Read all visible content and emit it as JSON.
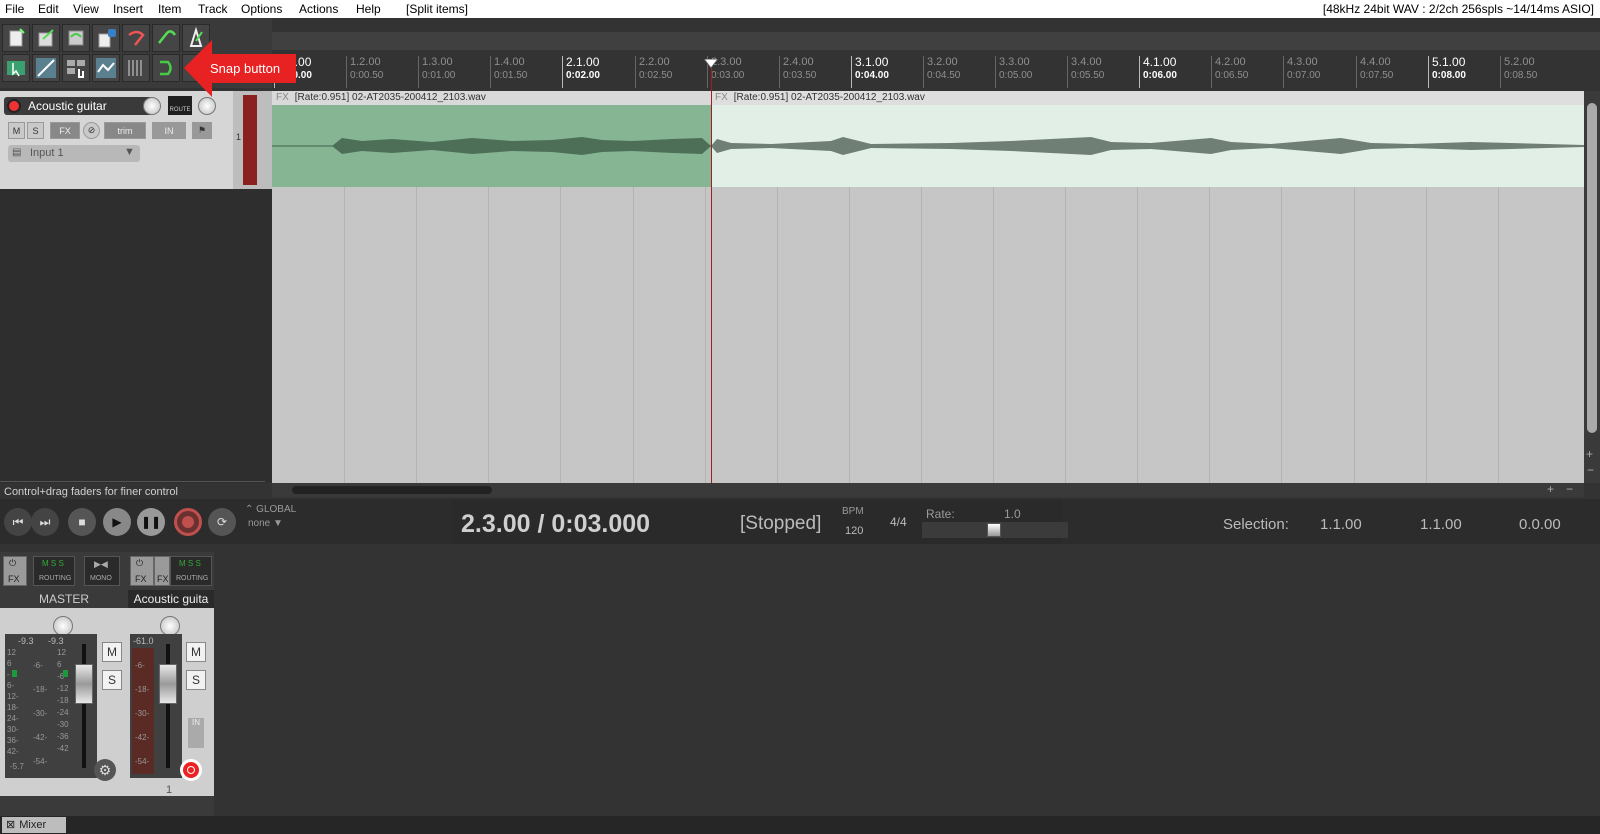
{
  "menu": {
    "items": [
      "File",
      "Edit",
      "View",
      "Insert",
      "Item",
      "Track",
      "Options",
      "Actions",
      "Help"
    ],
    "context": "[Split items]",
    "audio_status": "[48kHz 24bit WAV : 2/2ch 256spls ~14/14ms ASIO]"
  },
  "annotation": {
    "snap_label": "Snap button",
    "color": "#e82222"
  },
  "ruler": {
    "labels": [
      {
        "bar": "1.1.00",
        "time": "0:00.00",
        "major": true
      },
      {
        "bar": "1.2.00",
        "time": "0:00.50",
        "major": false
      },
      {
        "bar": "1.3.00",
        "time": "0:01.00",
        "major": false
      },
      {
        "bar": "1.4.00",
        "time": "0:01.50",
        "major": false
      },
      {
        "bar": "2.1.00",
        "time": "0:02.00",
        "major": true
      },
      {
        "bar": "2.2.00",
        "time": "0:02.50",
        "major": false
      },
      {
        "bar": "2.3.00",
        "time": "0:03.00",
        "major": false
      },
      {
        "bar": "2.4.00",
        "time": "0:03.50",
        "major": false
      },
      {
        "bar": "3.1.00",
        "time": "0:04.00",
        "major": true
      },
      {
        "bar": "3.2.00",
        "time": "0:04.50",
        "major": false
      },
      {
        "bar": "3.3.00",
        "time": "0:05.00",
        "major": false
      },
      {
        "bar": "3.4.00",
        "time": "0:05.50",
        "major": false
      },
      {
        "bar": "4.1.00",
        "time": "0:06.00",
        "major": true
      },
      {
        "bar": "4.2.00",
        "time": "0:06.50",
        "major": false
      },
      {
        "bar": "4.3.00",
        "time": "0:07.00",
        "major": false
      },
      {
        "bar": "4.4.00",
        "time": "0:07.50",
        "major": false
      },
      {
        "bar": "5.1.00",
        "time": "0:08.00",
        "major": true
      },
      {
        "bar": "5.2.00",
        "time": "0:08.50",
        "major": false
      }
    ]
  },
  "track": {
    "name": "Acoustic guitar",
    "number": "1",
    "input": "Input 1",
    "buttons": {
      "mute": "M",
      "solo": "S",
      "fx": "FX",
      "trim": "trim",
      "in": "IN",
      "route": "ROUTE"
    }
  },
  "items": [
    {
      "label": "[Rate:0.951] 02-AT2035-200412_2103.wav",
      "fx": "FX",
      "color": "#86b594"
    },
    {
      "label": "[Rate:0.951] 02-AT2035-200412_2103.wav",
      "fx": "FX",
      "color": "#e1efe6"
    }
  ],
  "hint": "Control+drag faders for finer control",
  "transport": {
    "position": "2.3.00 / 0:03.000",
    "state": "[Stopped]",
    "global_label": "GLOBAL",
    "global_value": "none",
    "bpm_label": "BPM",
    "bpm": "120",
    "timesig": "4/4",
    "rate_label": "Rate:",
    "rate": "1.0",
    "rate_level": 0.5,
    "selection_label": "Selection:",
    "selection_start": "1.1.00",
    "selection_end": "1.1.00",
    "selection_length": "0.0.00"
  },
  "mixer": {
    "master": {
      "name": "MASTER",
      "peak_l": "-9.3",
      "peak_r": "-9.3",
      "scale_left": [
        "12",
        "6",
        "-",
        "6-",
        "12-",
        "18-",
        "24-",
        "30-",
        "36-",
        "42-"
      ],
      "scale_mid": [
        "-6-",
        "-18-",
        "-30-",
        "-42-",
        "-54-"
      ],
      "scale_right": [
        "12",
        "6",
        "-6",
        "-12",
        "-18",
        "-24",
        "-30",
        "-36",
        "-42"
      ],
      "bottom": "-5.7",
      "buttons": {
        "fx": "FX",
        "routing": "ROUTING",
        "mono": "MONO",
        "mute": "M",
        "solo": "S"
      }
    },
    "track": {
      "name": "Acoustic guita",
      "peak": "-61.0",
      "scale": [
        "-6-",
        "-18-",
        "-30-",
        "-42-",
        "-54-"
      ],
      "number": "1",
      "buttons": {
        "fx": "FX",
        "fx2": "FX",
        "routing": "ROUTING",
        "mute": "M",
        "solo": "S",
        "in": "IN"
      }
    },
    "tab": "Mixer"
  }
}
